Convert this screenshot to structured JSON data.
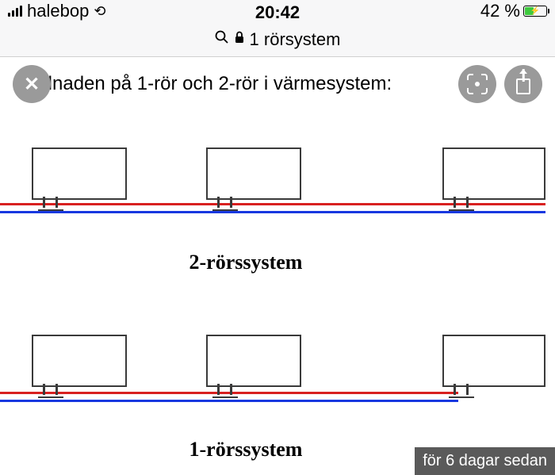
{
  "status": {
    "carrier": "halebop",
    "time": "20:42",
    "battery_text": "42 %"
  },
  "urlbar": {
    "text": "1 rörsystem"
  },
  "page": {
    "heading": "Skillnaden på 1-rör och 2-rör i värmesystem:",
    "label_2pipe": "2-rörssystem",
    "label_1pipe": "1-rörssystem"
  },
  "footer": {
    "timestamp": "för 6 dagar sedan"
  }
}
